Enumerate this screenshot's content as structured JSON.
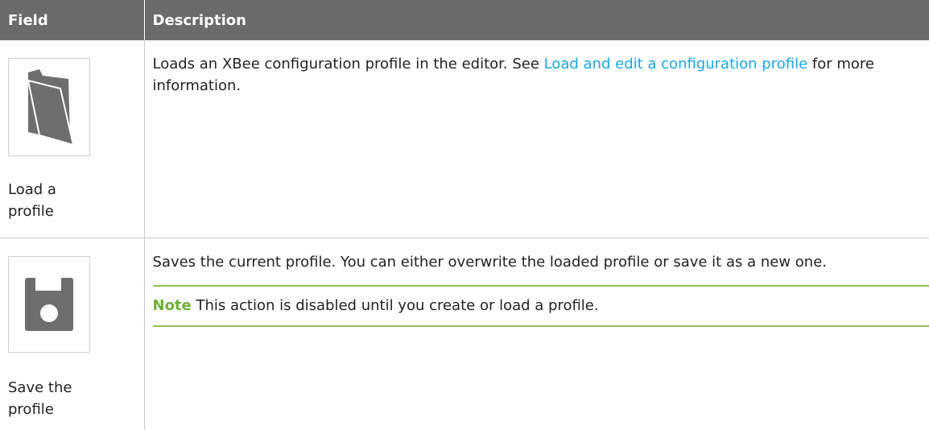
{
  "table": {
    "headers": {
      "field": "Field",
      "description": "Description"
    },
    "rows": [
      {
        "icon": "folder-open-icon",
        "field_label": "Load a profile",
        "description_before_link": "Loads an XBee configuration profile in the editor. See ",
        "link_text": "Load and edit a configuration profile",
        "description_after_link": " for more information."
      },
      {
        "icon": "floppy-disk-icon",
        "field_label": "Save the profile",
        "description": "Saves the current profile. You can either overwrite the loaded profile or save it as a new one.",
        "note_label": "Note",
        "note_text": " This action is disabled until you create or load a profile."
      }
    ]
  },
  "colors": {
    "header_bg": "#6b6b6b",
    "link": "#19a7e6",
    "note_accent": "#8ec44f",
    "icon_gray": "#6e6e6e"
  }
}
